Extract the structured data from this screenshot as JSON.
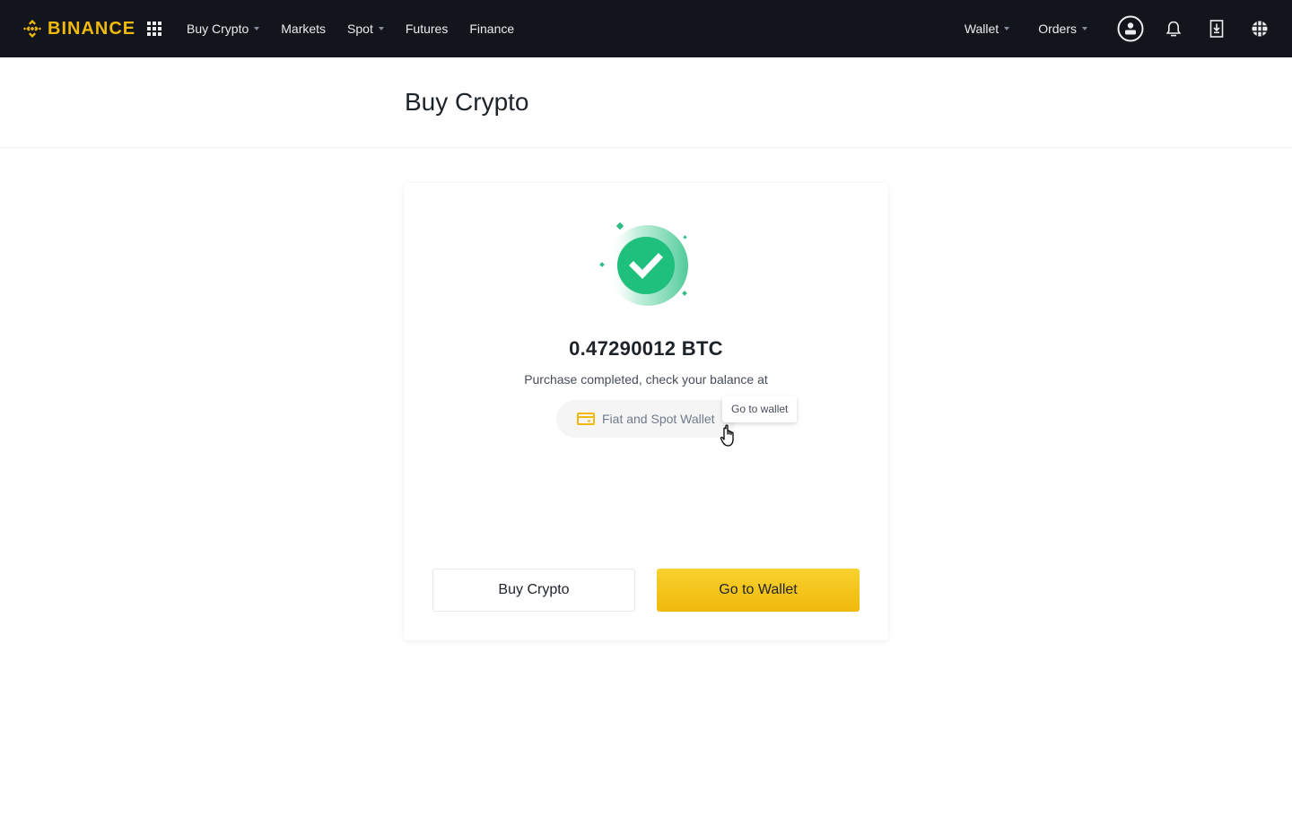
{
  "header": {
    "brand": "BINANCE",
    "brand_color": "#f0b90b",
    "apps_icon": "grid-icon",
    "nav": [
      {
        "label": "Buy Crypto",
        "has_dropdown": true
      },
      {
        "label": "Markets",
        "has_dropdown": false
      },
      {
        "label": "Spot",
        "has_dropdown": true
      },
      {
        "label": "Futures",
        "has_dropdown": false
      },
      {
        "label": "Finance",
        "has_dropdown": false
      }
    ],
    "right_nav": [
      {
        "label": "Wallet",
        "has_dropdown": true
      },
      {
        "label": "Orders",
        "has_dropdown": true
      }
    ],
    "icons": [
      "user-icon",
      "bell-icon",
      "download-icon",
      "globe-icon"
    ]
  },
  "page": {
    "title": "Buy Crypto"
  },
  "result": {
    "status_icon": "success-check-icon",
    "amount": "0.47290012 BTC",
    "message": "Purchase completed, check your balance at",
    "wallet_label": "Fiat and Spot Wallet",
    "wallet_icon": "wallet-icon",
    "tooltip": "Go to wallet",
    "success_color": "#2ebd85"
  },
  "actions": {
    "secondary_label": "Buy Crypto",
    "primary_label": "Go to Wallet"
  }
}
